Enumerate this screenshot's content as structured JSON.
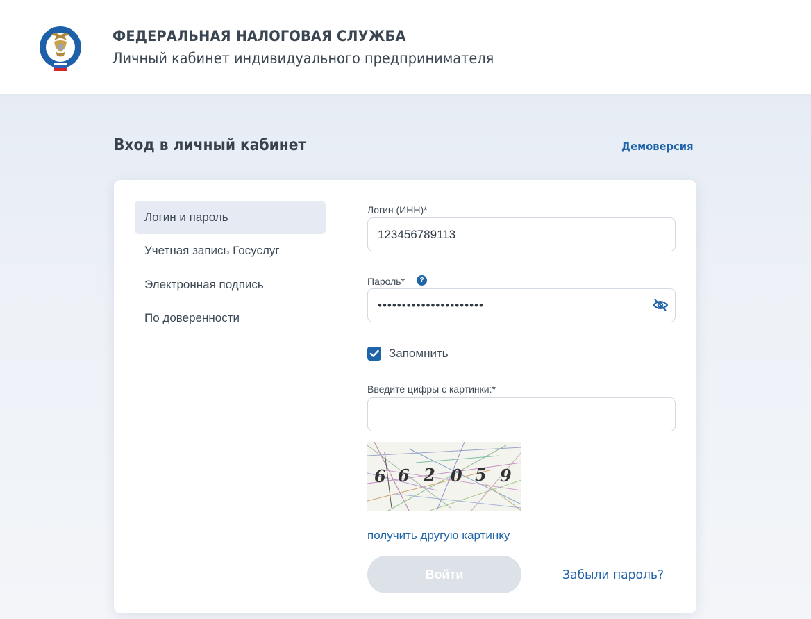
{
  "header": {
    "org_name": "ФЕДЕРАЛЬНАЯ НАЛОГОВАЯ СЛУЖБА",
    "subtitle": "Личный кабинет индивидуального предпринимателя",
    "logo_icon": "fns-emblem-icon",
    "logo_ring_text": "ФЕДЕРАЛЬНАЯ НАЛОГОВАЯ СЛУЖБА"
  },
  "page": {
    "title": "Вход в личный кабинет",
    "demo_link": "Демоверсия"
  },
  "methods": [
    {
      "label": "Логин и пароль",
      "active": true
    },
    {
      "label": "Учетная запись Госуслуг",
      "active": false
    },
    {
      "label": "Электронная подпись",
      "active": false
    },
    {
      "label": "По доверенности",
      "active": false
    }
  ],
  "form": {
    "login_label": "Логин (ИНН)*",
    "login_value": "123456789113",
    "password_label": "Пароль*",
    "password_help_icon": "question-icon",
    "password_value": "••••••••••••••••••••••",
    "password_toggle_icon": "eye-slash-icon",
    "remember_label": "Запомнить",
    "remember_checked": true,
    "captcha_label": "Введите цифры с картинки:*",
    "captcha_value": "",
    "captcha_digits": [
      "6",
      "6",
      "2",
      "0",
      "5",
      "9"
    ],
    "captcha_refresh_link": "получить другую картинку",
    "submit_label": "Войти",
    "forgot_link": "Забыли пароль?"
  },
  "colors": {
    "accent": "#1f64a8",
    "text": "#3a4652",
    "active_tab_bg": "#e6ebf3",
    "disabled_button_bg": "#dde2e8",
    "input_border": "#d3d9e1"
  }
}
